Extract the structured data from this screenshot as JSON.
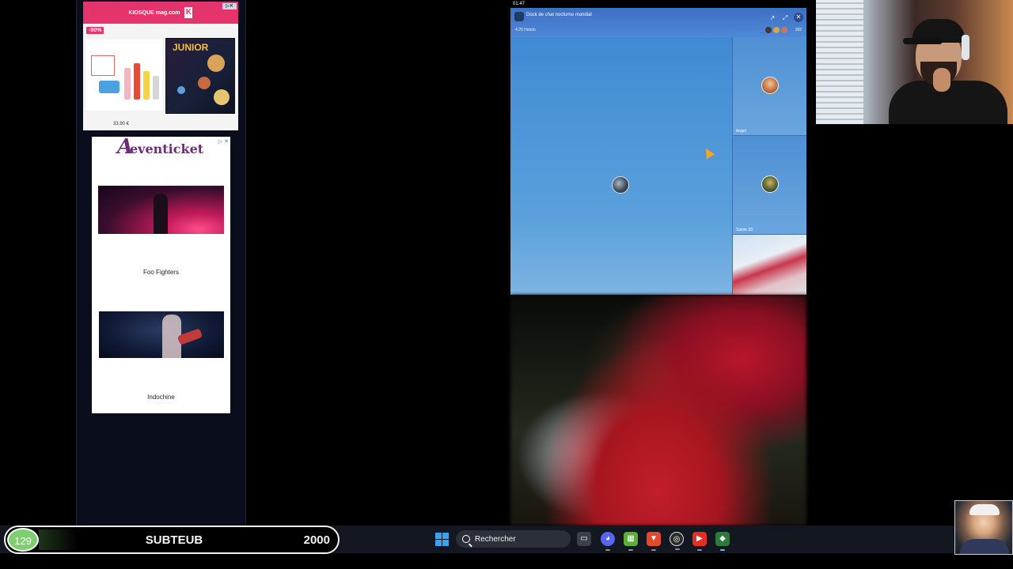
{
  "ads": {
    "ad1": {
      "brand": "KIOSQUE mag.com",
      "badge": "-90%",
      "mag_title": "JUNIOR",
      "price": "33,90 €"
    },
    "ad2": {
      "logo": "eventicket",
      "corner": "▷ ✕",
      "items": [
        {
          "caption": "Foo Fighters"
        },
        {
          "caption": "Indochine"
        }
      ]
    }
  },
  "chat_app": {
    "status_time": "01:47",
    "title": "Dock de chat nocturne mondial",
    "sub": "4:25 Hebdo",
    "participant_count": "192",
    "tiles": [
      {
        "name": "Angel"
      },
      {
        "name": "Sainte 03"
      },
      {
        "name": ""
      }
    ]
  },
  "taskbar": {
    "search_placeholder": "Rechercher",
    "apps": [
      "task-view",
      "discord",
      "minecraft",
      "brave",
      "obs",
      "youtube",
      "app"
    ]
  },
  "sub_widget": {
    "count": "129",
    "label": "SUBTEUB",
    "goal": "2000",
    "progress": 0.0645
  },
  "colors": {
    "sub_green": "#7ed06e",
    "header_blue": "#4f88d8",
    "ad_pink": "#e5336b"
  }
}
